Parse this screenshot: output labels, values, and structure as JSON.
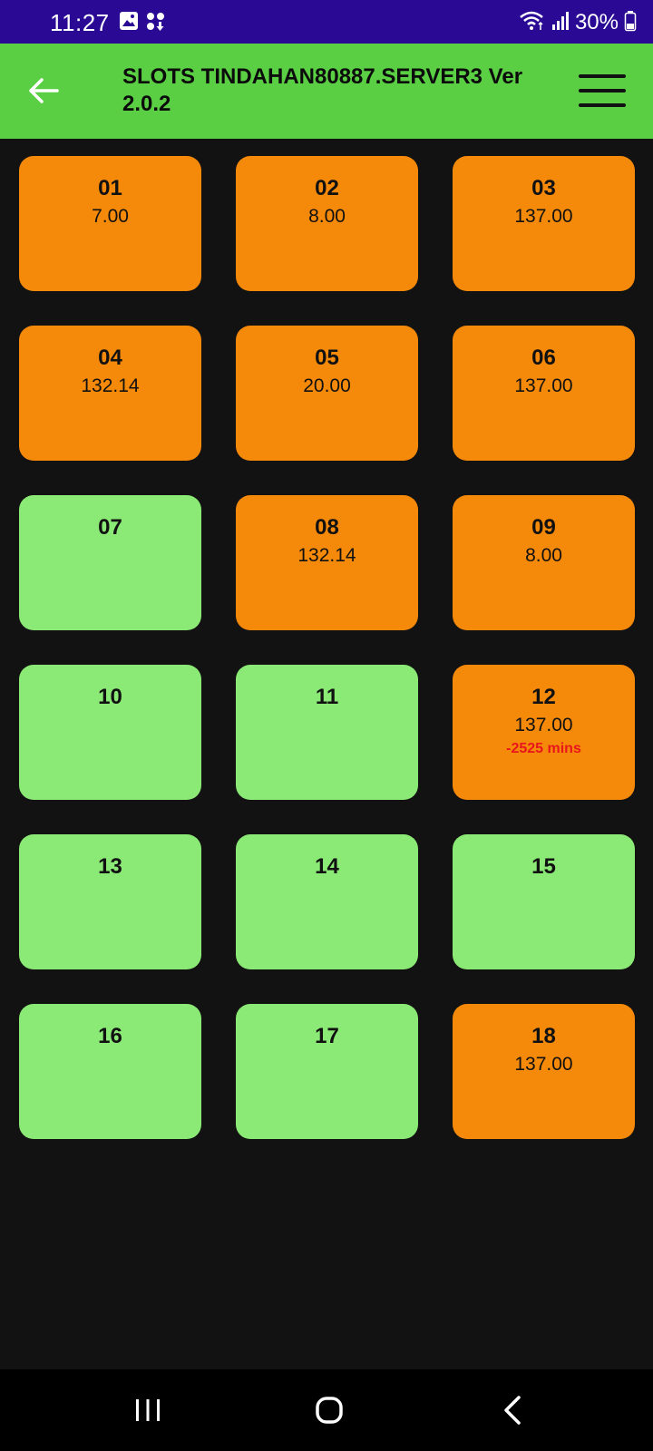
{
  "status_bar": {
    "time": "11:27",
    "battery": "30%",
    "icons": [
      "gallery-icon",
      "notification-apps-icon",
      "wifi-icon",
      "signal-icon",
      "battery-icon"
    ]
  },
  "app_bar": {
    "title": "SLOTS TINDAHAN80887.SERVER3 Ver 2.0.2",
    "back_icon": "arrow-left-icon",
    "menu_icon": "hamburger-menu-icon"
  },
  "colors": {
    "status_bar": "#2a0a94",
    "app_bar": "#5acf44",
    "background": "#121212",
    "occupied_slot": "#f5890a",
    "free_slot": "#8be976",
    "warning_text": "#e8151c"
  },
  "slots": [
    {
      "number": "01",
      "amount": "7.00",
      "status": "occupied",
      "note": ""
    },
    {
      "number": "02",
      "amount": "8.00",
      "status": "occupied",
      "note": ""
    },
    {
      "number": "03",
      "amount": "137.00",
      "status": "occupied",
      "note": ""
    },
    {
      "number": "04",
      "amount": "132.14",
      "status": "occupied",
      "note": ""
    },
    {
      "number": "05",
      "amount": "20.00",
      "status": "occupied",
      "note": ""
    },
    {
      "number": "06",
      "amount": "137.00",
      "status": "occupied",
      "note": ""
    },
    {
      "number": "07",
      "amount": "",
      "status": "free",
      "note": ""
    },
    {
      "number": "08",
      "amount": "132.14",
      "status": "occupied",
      "note": ""
    },
    {
      "number": "09",
      "amount": "8.00",
      "status": "occupied",
      "note": ""
    },
    {
      "number": "10",
      "amount": "",
      "status": "free",
      "note": ""
    },
    {
      "number": "11",
      "amount": "",
      "status": "free",
      "note": ""
    },
    {
      "number": "12",
      "amount": "137.00",
      "status": "occupied",
      "note": "-2525 mins"
    },
    {
      "number": "13",
      "amount": "",
      "status": "free",
      "note": ""
    },
    {
      "number": "14",
      "amount": "",
      "status": "free",
      "note": ""
    },
    {
      "number": "15",
      "amount": "",
      "status": "free",
      "note": ""
    },
    {
      "number": "16",
      "amount": "",
      "status": "free",
      "note": ""
    },
    {
      "number": "17",
      "amount": "",
      "status": "free",
      "note": ""
    },
    {
      "number": "18",
      "amount": "137.00",
      "status": "occupied",
      "note": ""
    }
  ],
  "nav_bar": {
    "icons": [
      "recent-apps-icon",
      "home-icon",
      "back-icon"
    ]
  }
}
